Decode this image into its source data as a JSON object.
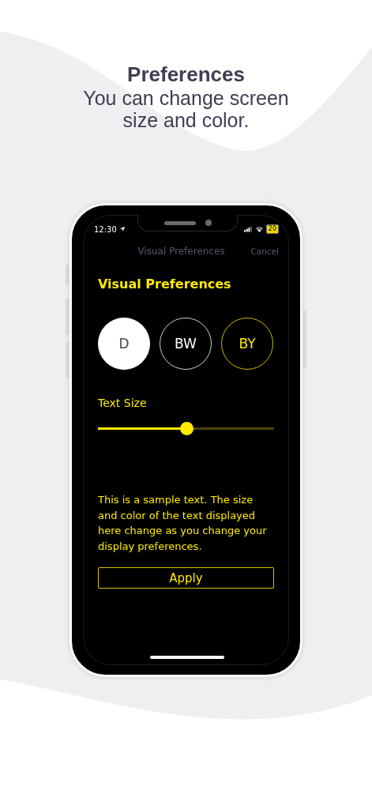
{
  "header": {
    "title": "Preferences",
    "subtitle": "You can change screen size and color."
  },
  "status_bar": {
    "time": "12:30",
    "battery": "20"
  },
  "nav_bar": {
    "title": "Visual Preferences",
    "cancel": "Cancel"
  },
  "heading": "Visual Preferences",
  "themes": [
    {
      "label": "D",
      "kind": "filled"
    },
    {
      "label": "BW",
      "kind": "white"
    },
    {
      "label": "BY",
      "kind": "yellow"
    }
  ],
  "text_size": {
    "label": "Text Size",
    "level": 0.5
  },
  "sample_text": "This is a sample text. The size and color of the text displayed here change as you change your display preferences.",
  "apply_button": "Apply"
}
